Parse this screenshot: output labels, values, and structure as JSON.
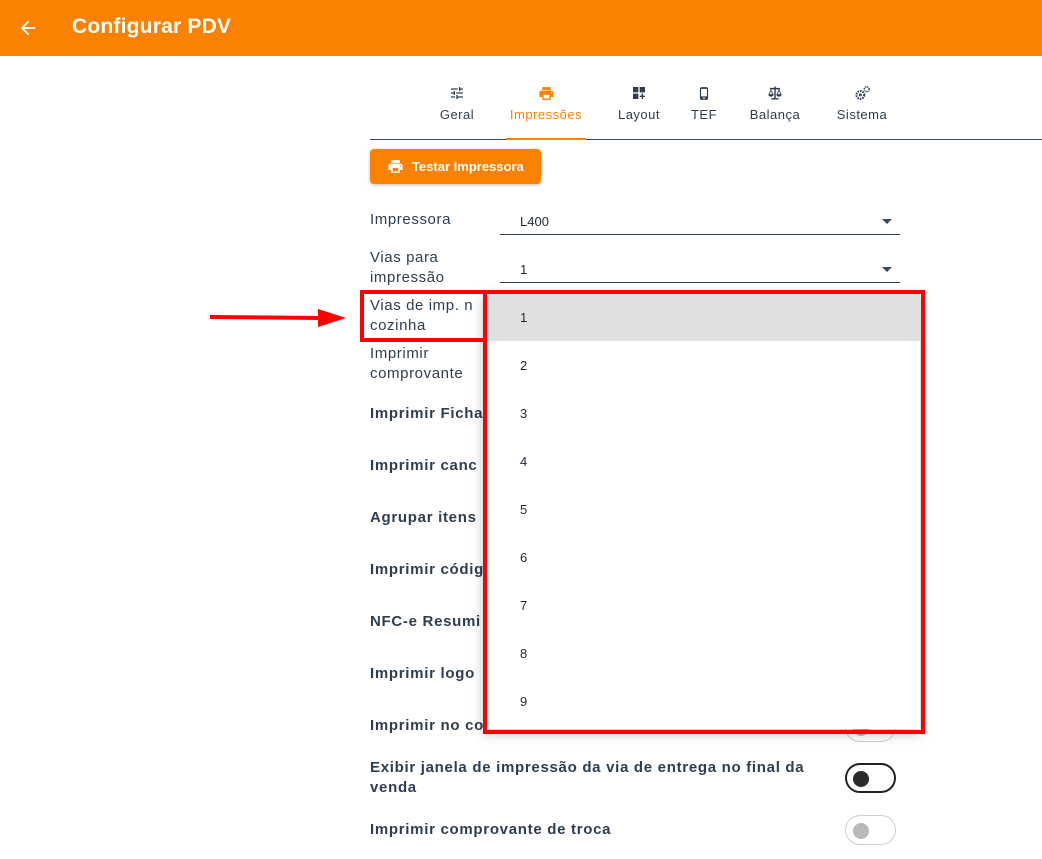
{
  "appbar": {
    "title": "Configurar PDV",
    "back_icon": "arrow-left-icon",
    "color": "#fb8101"
  },
  "tabs": [
    {
      "label": "Geral",
      "icon": "sliders-icon",
      "active": false
    },
    {
      "label": "Impressões",
      "icon": "printer-icon",
      "active": true
    },
    {
      "label": "Layout",
      "icon": "layout-grid-icon",
      "active": false
    },
    {
      "label": "TEF",
      "icon": "phone-icon",
      "active": false
    },
    {
      "label": "Balança",
      "icon": "scale-icon",
      "active": false
    },
    {
      "label": "Sistema",
      "icon": "gears-icon",
      "active": false
    }
  ],
  "test_button": {
    "label": "Testar Impressora",
    "icon": "printer-icon"
  },
  "fields": {
    "impressora": {
      "label": "Impressora",
      "value": "L400"
    },
    "vias": {
      "label_line1": "Vias para",
      "label_line2": "impressão",
      "value": "1"
    },
    "vias_cozinha": {
      "label_line1": "Vias de imp. n",
      "label_line2": "cozinha"
    },
    "comprovante": {
      "label_line1": "Imprimir",
      "label_line2": "comprovante"
    }
  },
  "settings": [
    {
      "label": "Imprimir Ficha"
    },
    {
      "label": "Imprimir canc"
    },
    {
      "label": "Agrupar itens"
    },
    {
      "label": "Imprimir códig"
    },
    {
      "label": "NFC-e Resumi"
    },
    {
      "label": "Imprimir logo"
    },
    {
      "label": "Imprimir no co"
    },
    {
      "label_line1": "Exibir janela de impressão da via de entrega no final da",
      "label_line2": "venda",
      "toggle_on": true
    },
    {
      "label": "Imprimir comprovante de troca",
      "toggle_on": false
    }
  ],
  "dropdown": {
    "options": [
      "1",
      "2",
      "3",
      "4",
      "5",
      "6",
      "7",
      "8",
      "9"
    ],
    "selected": "1"
  },
  "annotation": {
    "color": "#ff0000"
  }
}
